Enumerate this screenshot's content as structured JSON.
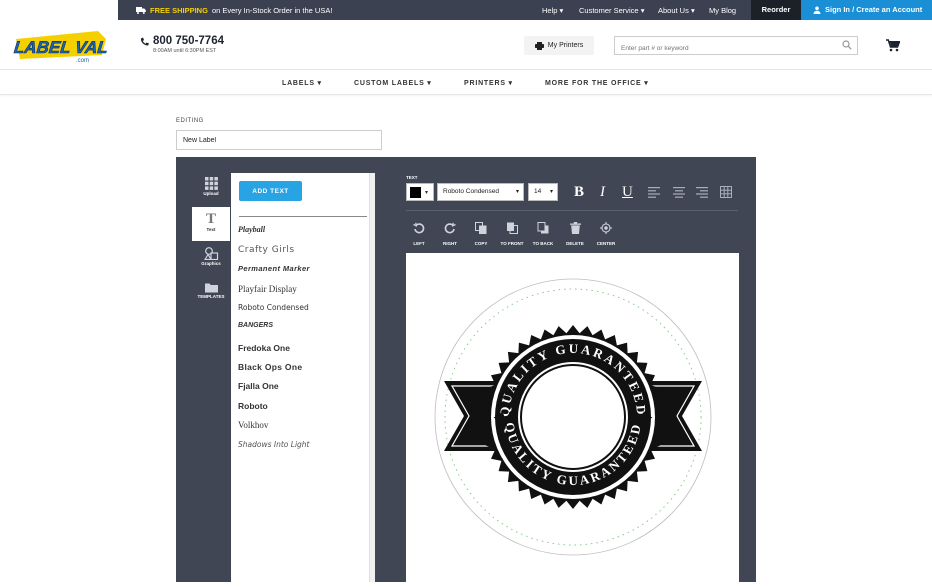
{
  "topbar": {
    "shipping_bold": "FREE SHIPPING",
    "shipping_rest": "on Every In-Stock Order in the USA!",
    "links": [
      "Help",
      "Customer Service",
      "About Us",
      "My Blog"
    ],
    "reorder": "Reorder",
    "signin": "Sign In / Create an Account"
  },
  "header": {
    "logo_text": "LABEL VALUE",
    "logo_sub": ".com",
    "phone": "800 750-7764",
    "hours": "8:00AM until 6:30PM EST",
    "my_printers": "My Printers",
    "search_placeholder": "Enter part # or keyword"
  },
  "nav": [
    "LABELS",
    "CUSTOM LABELS",
    "PRINTERS",
    "MORE FOR THE OFFICE"
  ],
  "editing": {
    "label": "EDITING",
    "value": "New Label"
  },
  "sidebar": {
    "tools": [
      {
        "label": "Upload",
        "icon": "grid-icon"
      },
      {
        "label": "Text",
        "icon": "text-icon",
        "active": true
      },
      {
        "label": "Graphics",
        "icon": "shapes-icon"
      },
      {
        "label": "TEMPLATES",
        "icon": "folder-icon"
      }
    ]
  },
  "text_panel": {
    "add_text": "ADD TEXT",
    "fonts": [
      "Playball",
      "Crafty Girls",
      "Permanent Marker",
      "Playfair Display",
      "Roboto Condensed",
      "BANGERS",
      "Fredoka One",
      "Black Ops One",
      "Fjalla One",
      "Roboto",
      "Volkhov",
      "Shadows Into Light"
    ]
  },
  "toolbar": {
    "label": "TEXT",
    "color": "#000000",
    "font": "Roboto Condensed",
    "size": "14",
    "format_buttons": [
      "B",
      "I",
      "U"
    ],
    "align_icons": [
      "align-left-icon",
      "align-center-icon",
      "align-right-icon",
      "table-icon"
    ],
    "actions": [
      {
        "label": "LEFT",
        "icon": "rotate-left-icon"
      },
      {
        "label": "RIGHT",
        "icon": "rotate-right-icon"
      },
      {
        "label": "COPY",
        "icon": "copy-icon"
      },
      {
        "label": "TO FRONT",
        "icon": "to-front-icon"
      },
      {
        "label": "TO BACK",
        "icon": "to-back-icon"
      },
      {
        "label": "DELETE",
        "icon": "trash-icon"
      },
      {
        "label": "CENTER",
        "icon": "crosshair-icon"
      }
    ]
  },
  "canvas": {
    "seal_text_top": "QUALITY GUARANTEED",
    "seal_text_bottom": "QUALITY GUARANTEED"
  },
  "colors": {
    "topbar": "#3b4150",
    "accent_blue": "#1a8fd6",
    "button_blue": "#28a3e3",
    "editor_bg": "#414655",
    "shipping_yellow": "#f5d000"
  }
}
